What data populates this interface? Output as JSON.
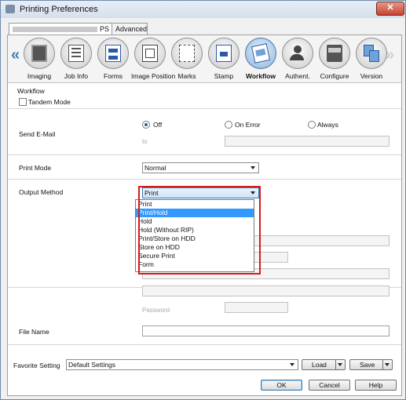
{
  "window": {
    "title": "Printing Preferences",
    "close_label": "✕"
  },
  "tabs": [
    {
      "label": "PS"
    },
    {
      "label": "Advanced"
    }
  ],
  "toolbar": {
    "prev_label": "«",
    "next_label": "»",
    "items": [
      {
        "label": "Imaging",
        "icon": "imaging-icon"
      },
      {
        "label": "Job Info",
        "icon": "job-info-icon"
      },
      {
        "label": "Forms",
        "icon": "forms-icon"
      },
      {
        "label": "Image Position",
        "icon": "image-position-icon"
      },
      {
        "label": "Marks",
        "icon": "marks-icon"
      },
      {
        "label": "Stamp",
        "icon": "stamp-icon"
      },
      {
        "label": "Workflow",
        "icon": "workflow-icon",
        "selected": true
      },
      {
        "label": "Authent.",
        "icon": "authentication-icon"
      },
      {
        "label": "Configure",
        "icon": "configure-icon"
      },
      {
        "label": "Version",
        "icon": "version-icon"
      }
    ]
  },
  "workflow": {
    "section_title": "Workflow",
    "tandem_label": "Tandem Mode",
    "send_email": {
      "label": "Send E-Mail",
      "options": [
        "Off",
        "On Error",
        "Always"
      ],
      "selected": "Off",
      "to_label": "to"
    },
    "print_mode": {
      "label": "Print Mode",
      "value": "Normal"
    },
    "output_method": {
      "label": "Output Method",
      "value": "Print",
      "options": [
        "Print",
        "Print/Hold",
        "Hold",
        "Hold (Without RIP)",
        "Print/Store on HDD",
        "Store on HDD",
        "Secure Print",
        "Form"
      ],
      "highlighted": "Print/Hold"
    },
    "password_label": "Password",
    "file_name_label": "File Name"
  },
  "favorite": {
    "label": "Favorite Setting",
    "value": "Default Settings",
    "load_label": "Load",
    "save_label": "Save"
  },
  "buttons": {
    "ok": "OK",
    "cancel": "Cancel",
    "help": "Help"
  },
  "colors": {
    "accent": "#3399ff",
    "highlight_box": "#d61b1b",
    "selected_icon": "#8cb4da"
  }
}
